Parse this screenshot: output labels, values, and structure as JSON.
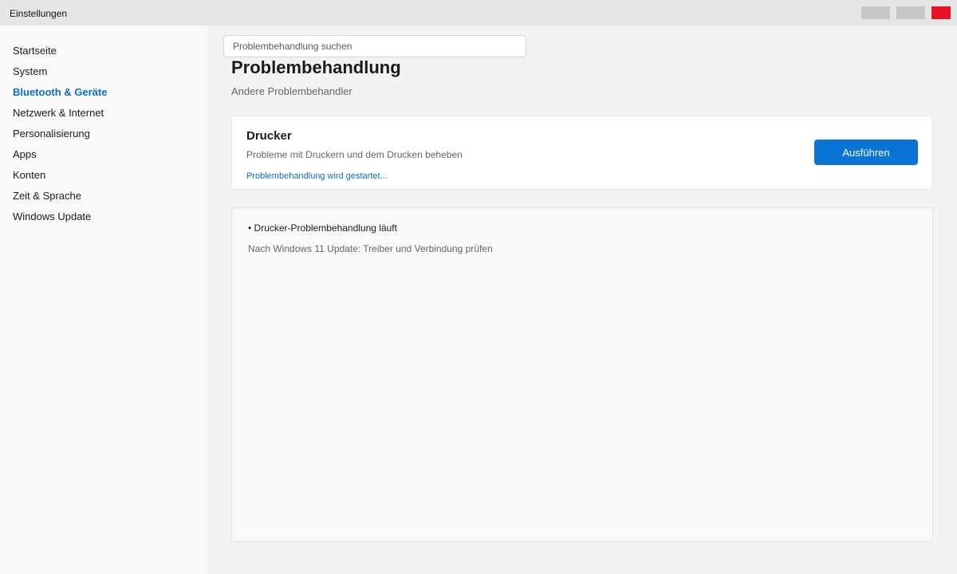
{
  "window": {
    "title": "Einstellungen",
    "controls": {
      "minimize": "minimize",
      "maximize": "maximize",
      "close": "close"
    },
    "close_color": "#e81123"
  },
  "sidebar": {
    "items": [
      {
        "label": "Startseite",
        "active": false
      },
      {
        "label": "System",
        "active": false
      },
      {
        "label": "Bluetooth & Geräte",
        "active": true
      },
      {
        "label": "Netzwerk & Internet",
        "active": false
      },
      {
        "label": "Personalisierung",
        "active": false
      },
      {
        "label": "Apps",
        "active": false
      },
      {
        "label": "Konten",
        "active": false
      },
      {
        "label": "Zeit & Sprache",
        "active": false
      },
      {
        "label": "Windows Update",
        "active": false
      }
    ]
  },
  "search": {
    "placeholder": "Problembehandlung suchen"
  },
  "page": {
    "title": "Problembehandlung",
    "subtitle": "Andere Problembehandler"
  },
  "card": {
    "title": "Drucker",
    "description": "Probleme mit Druckern und dem Drucken beheben",
    "status": "Problembehandlung wird gestartet...",
    "button_label": "Ausführen"
  },
  "panel": {
    "line1": "• Drucker-Problembehandlung läuft",
    "line2": "Nach Windows 11 Update: Treiber und Verbindung prüfen"
  },
  "colors": {
    "accent": "#0a74d6",
    "link": "#0a6fc7"
  }
}
